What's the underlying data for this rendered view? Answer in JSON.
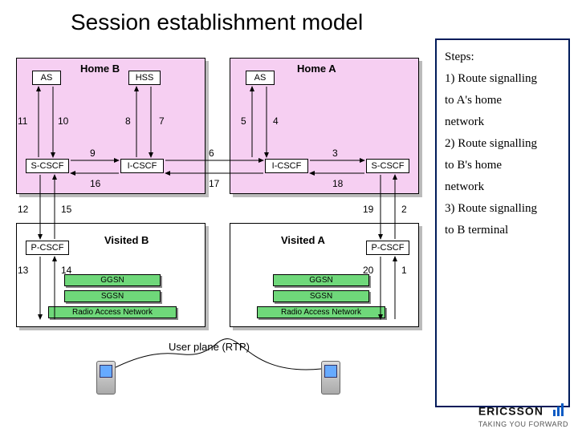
{
  "title": "Session establishment model",
  "steps": {
    "heading": "Steps:",
    "items": [
      "1) Route signalling",
      "to A's home",
      "network",
      "2) Route signalling",
      "to B's home",
      "network",
      "3) Route signalling",
      "to B terminal"
    ]
  },
  "regions": {
    "homeB": "Home B",
    "homeA": "Home A",
    "visitedB": "Visited B",
    "visitedA": "Visited A"
  },
  "nodes": {
    "asB": "AS",
    "asA": "AS",
    "hss": "HSS",
    "scscfB": "S-CSCF",
    "scscfA": "S-CSCF",
    "icscfB": "I-CSCF",
    "icscfA": "I-CSCF",
    "pcscfB": "P-CSCF",
    "pcscfA": "P-CSCF",
    "ggsnB": "GGSN",
    "ggsnA": "GGSN",
    "sgsnB": "SGSN",
    "sgsnA": "SGSN",
    "ranB": "Radio Access Network",
    "ranA": "Radio Access Network"
  },
  "numbers": {
    "n1": "1",
    "n2": "2",
    "n3": "3",
    "n4": "4",
    "n5": "5",
    "n6": "6",
    "n7": "7",
    "n8": "8",
    "n9": "9",
    "n10": "10",
    "n11": "11",
    "n12": "12",
    "n13": "13",
    "n14": "14",
    "n15": "15",
    "n16": "16",
    "n17": "17",
    "n18": "18",
    "n19": "19",
    "n20": "20"
  },
  "userplane": "User plane (RTP)",
  "brand": {
    "name": "ERICSSON",
    "tag": "TAKING YOU FORWARD"
  }
}
